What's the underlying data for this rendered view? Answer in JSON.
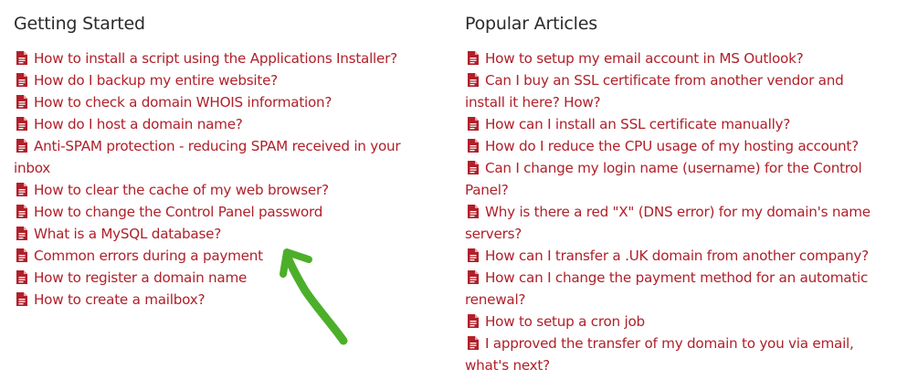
{
  "getting_started": {
    "heading": "Getting Started",
    "items": [
      {
        "label": "How to install a script using the Applications Installer?"
      },
      {
        "label": "How do I backup my entire website?"
      },
      {
        "label": "How to check a domain WHOIS information?"
      },
      {
        "label": "How do I host a domain name?"
      },
      {
        "label": "Anti-SPAM protection - reducing SPAM received in your inbox"
      },
      {
        "label": "How to clear the cache of my web browser?"
      },
      {
        "label": "How to change the Control Panel password"
      },
      {
        "label": "What is a MySQL database?"
      },
      {
        "label": "Common errors during a payment"
      },
      {
        "label": "How to register a domain name"
      },
      {
        "label": "How to create a mailbox?"
      }
    ]
  },
  "popular_articles": {
    "heading": "Popular Articles",
    "items": [
      {
        "label": "How to setup my email account in MS Outlook?"
      },
      {
        "label": "Can I buy an SSL certificate from another vendor and install it here? How?"
      },
      {
        "label": "How can I install an SSL certificate manually?"
      },
      {
        "label": "How do I reduce the CPU usage of my hosting account?"
      },
      {
        "label": "Can I change my login name (username) for the Control Panel?"
      },
      {
        "label": "Why is there a red \"X\" (DNS error) for my domain's name servers?"
      },
      {
        "label": "How can I transfer a .UK domain from another company?"
      },
      {
        "label": "How can I change the payment method for an automatic renewal?"
      },
      {
        "label": "How to setup a cron job"
      },
      {
        "label": "I approved the transfer of my domain to you via email, what's next?"
      }
    ]
  },
  "icons": {
    "article": "document-icon",
    "annotation": "green-arrow-icon"
  },
  "colors": {
    "link": "#b0202a",
    "heading": "#2b2b2b",
    "arrow": "#4caf2a"
  }
}
